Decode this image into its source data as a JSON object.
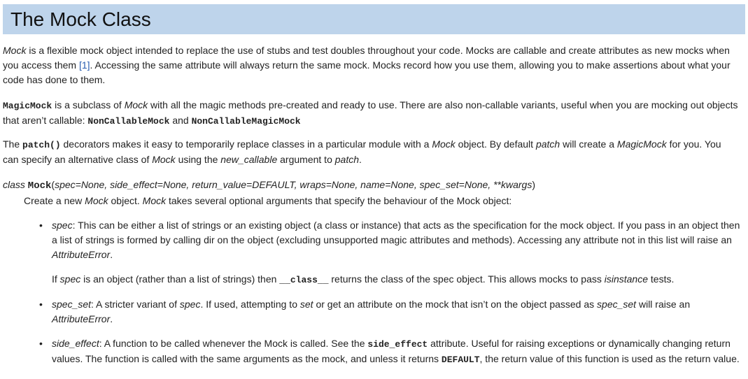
{
  "title": "The Mock Class",
  "p1": {
    "a": "Mock",
    "b": " is a flexible mock object intended to replace the use of stubs and test doubles throughout your code. Mocks are callable and create attributes as new mocks when you access them ",
    "link": "[1]",
    "c": ". Accessing the same attribute will always return the same mock. Mocks record how you use them, allowing you to make assertions about what your code has done to them."
  },
  "p2": {
    "code1": "MagicMock",
    "a": " is a subclass of ",
    "em1": "Mock",
    "b": " with all the magic methods pre-created and ready to use. There are also non-callable variants, useful when you are mocking out objects that aren’t callable: ",
    "code2": "NonCallableMock",
    "c": " and ",
    "code3": "NonCallableMagicMock"
  },
  "p3": {
    "a": "The ",
    "code1": "patch()",
    "b": " decorators makes it easy to temporarily replace classes in a particular module with a ",
    "em1": "Mock",
    "c": " object. By default ",
    "em2": "patch",
    "d": " will create a ",
    "em3": "MagicMock",
    "e": " for you. You can specify an alternative class of ",
    "em4": "Mock",
    "f": " using the ",
    "em5": "new_callable",
    "g": " argument to ",
    "em6": "patch",
    "h": "."
  },
  "signature": {
    "keyword": "class ",
    "name": "Mock",
    "open": "(",
    "params": "spec=None, side_effect=None, return_value=DEFAULT, wraps=None, name=None, spec_set=None, **kwargs",
    "close": ")"
  },
  "desc": {
    "a": "Create a new ",
    "em1": "Mock",
    "b": " object. ",
    "em2": "Mock",
    "c": " takes several optional arguments that specify the behaviour of the Mock object:"
  },
  "bullet_char": "•",
  "item1": {
    "em1": "spec",
    "a": ": This can be either a list of strings or an existing object (a class or instance) that acts as the specification for the mock object. If you pass in an object then a list of strings is formed by calling dir on the object (excluding unsupported magic attributes and methods). Accessing any attribute not in this list will raise an ",
    "em2": "AttributeError",
    "b": "."
  },
  "item1b": {
    "a": "If ",
    "em1": "spec",
    "b": " is an object (rather than a list of strings) then ",
    "code1": "__class__",
    "c": " returns the class of the spec object. This allows mocks to pass ",
    "em2": "isinstance",
    "d": " tests."
  },
  "item2": {
    "em1": "spec_set",
    "a": ": A stricter variant of ",
    "em2": "spec",
    "b": ". If used, attempting to ",
    "em3": "set",
    "c": " or get an attribute on the mock that isn’t on the object passed as ",
    "em4": "spec_set",
    "d": " will raise an ",
    "em5": "AttributeError",
    "e": "."
  },
  "item3": {
    "em1": "side_effect",
    "a": ": A function to be called whenever the Mock is called. See the ",
    "code1": "side_effect",
    "b": " attribute. Useful for raising exceptions or dynamically changing return values. The function is called with the same arguments as the mock, and unless it returns ",
    "code2": "DEFAULT",
    "c": ", the return value of this function is used as the return value."
  }
}
